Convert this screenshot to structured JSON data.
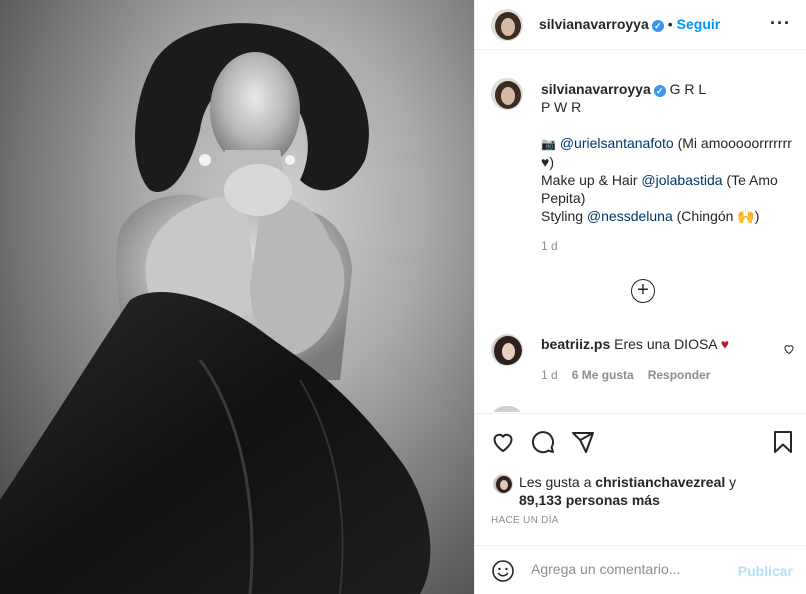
{
  "post": {
    "image_alt": "Black and white portrait"
  },
  "header": {
    "username": "silvianavarroyya",
    "verified_badge": "✓",
    "separator": "•",
    "follow_label": "Seguir",
    "more_label": "···"
  },
  "caption": {
    "username": "silvianavarroyya",
    "text_line1": "G R L",
    "text_line2": "P W R",
    "camera_icon": "📷",
    "photographer_mention": "@urielsantanafoto",
    "photographer_note": " (Mi amooooorrrrrrr ♥)",
    "makeup_prefix": "Make up & Hair ",
    "makeup_mention": "@jolabastida",
    "makeup_note": " (Te Amo Pepita)",
    "styling_prefix": "Styling ",
    "styling_mention": "@nessdeluna",
    "styling_note": " (Chingón 🙌)",
    "time": "1 d"
  },
  "load_more_label": "+",
  "comment": {
    "username": "beatriiz.ps",
    "text": "Eres una DIOSA",
    "heart": "♥",
    "time": "1 d",
    "likes": "6 Me gusta",
    "reply_label": "Responder"
  },
  "likes": {
    "prefix": "Les gusta a ",
    "user": "christianchavezreal",
    "middle": " y",
    "count": "89,133 personas más"
  },
  "timestamp": "HACE UN DÍA",
  "add_comment": {
    "placeholder": "Agrega un comentario...",
    "publish_label": "Publicar"
  },
  "colors": {
    "accent": "#0095f6",
    "verified": "#3897f0",
    "publish_disabled": "#b2dffc",
    "heart_red": "#c0152a"
  }
}
